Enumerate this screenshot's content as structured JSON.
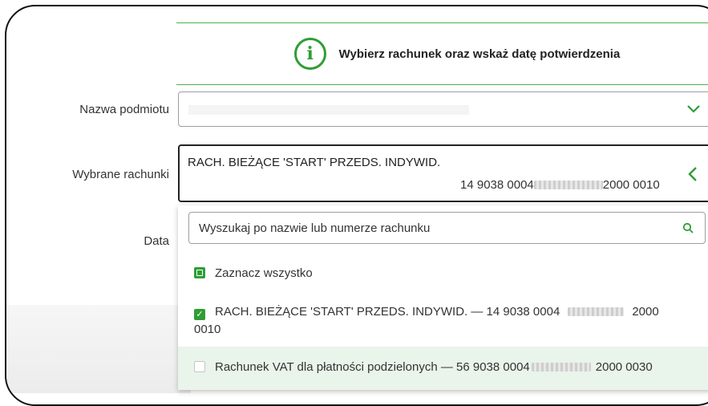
{
  "banner": {
    "text": "Wybierz rachunek oraz wskaż datę potwierdzenia",
    "icon": "info-icon"
  },
  "form": {
    "entity_label": "Nazwa podmiotu",
    "entity_value": "",
    "accounts_label": "Wybrane rachunki",
    "selected_account_name": "RACH. BIEŻĄCE 'START' PRZEDS. INDYWID.",
    "selected_account_num_start": "14 9038 0004",
    "selected_account_num_end": "2000 0010",
    "date_label": "Data"
  },
  "dropdown": {
    "search_placeholder": "Wyszukaj po nazwie lub numerze rachunku",
    "select_all_label": "Zaznacz wszystko",
    "options": [
      {
        "label_start": "RACH. BIEŻĄCE 'START' PRZEDS. INDYWID. — 14 9038 0004",
        "label_end": "2000",
        "label_wrap": "0010",
        "checked": true
      },
      {
        "label_start": "Rachunek VAT dla płatności podzielonych — 56 9038 0004",
        "label_end": "2000 0030",
        "checked": false
      }
    ]
  },
  "colors": {
    "accent": "#2e9e35",
    "highlight": "#e9f4ea"
  }
}
